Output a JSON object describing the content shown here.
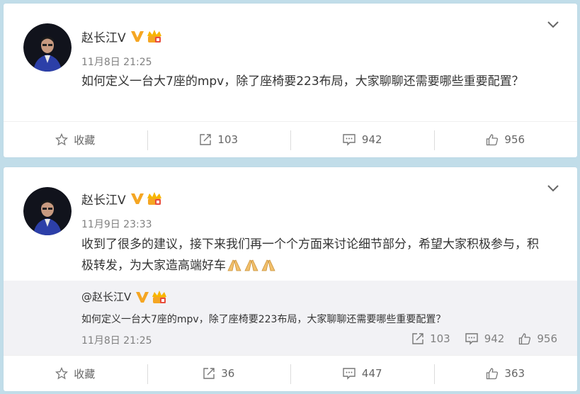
{
  "posts": [
    {
      "author": "赵长江V",
      "time": "11月8日 21:25",
      "text": "如何定义一台大7座的mpv，除了座椅要223布局，大家聊聊还需要哪些重要配置？",
      "actions": {
        "favorite": "收藏",
        "repost": "103",
        "comment": "942",
        "like": "956"
      }
    },
    {
      "author": "赵长江V",
      "time": "11月9日 23:33",
      "text": "收到了很多的建议，接下来我们再一个个方面来讨论细节部分，希望大家积极参与，积极转发，为大家造高端好车",
      "emoji": [
        "praying-hands-emoji",
        "praying-hands-emoji",
        "praying-hands-emoji"
      ],
      "repost": {
        "author": "@赵长江V",
        "text": "如何定义一台大7座的mpv，除了座椅要223布局，大家聊聊还需要哪些重要配置？",
        "time": "11月8日 21:25",
        "repost_count": "103",
        "comment_count": "942",
        "like_count": "956"
      },
      "actions": {
        "favorite": "收藏",
        "repost": "36",
        "comment": "447",
        "like": "363"
      }
    }
  ],
  "colors": {
    "background": "#c1dde9",
    "badge": "#f5a623",
    "vip": "#f7b500"
  }
}
